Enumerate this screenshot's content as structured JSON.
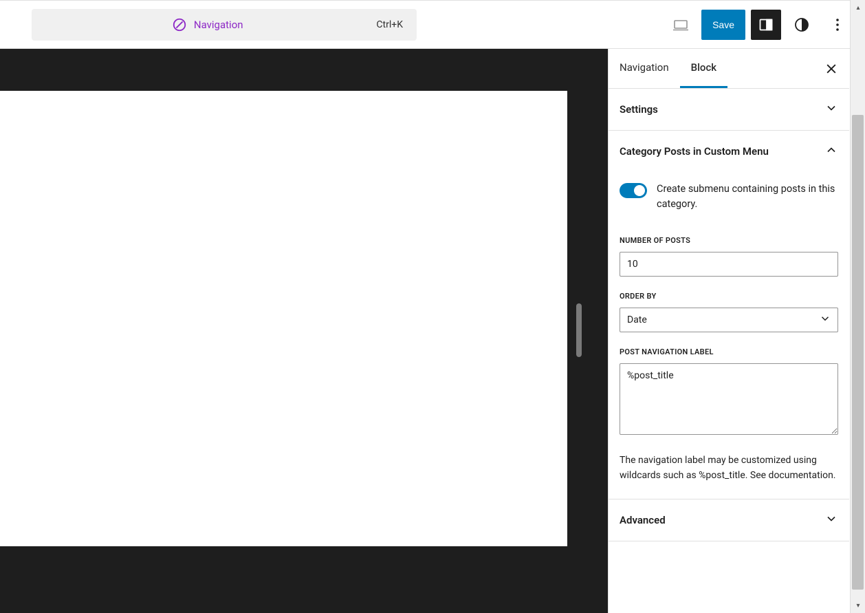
{
  "topbar": {
    "nav_label": "Navigation",
    "shortcut": "Ctrl+K",
    "save_label": "Save"
  },
  "sidebar": {
    "tabs": {
      "navigation": "Navigation",
      "block": "Block"
    },
    "panels": {
      "settings": {
        "title": "Settings"
      },
      "category_posts": {
        "title": "Category Posts in Custom Menu",
        "toggle_label": "Create submenu containing posts in this category.",
        "number_of_posts": {
          "label": "Number of posts",
          "value": "10"
        },
        "order_by": {
          "label": "Order by",
          "value": "Date"
        },
        "post_nav_label": {
          "label": "Post navigation label",
          "value": "%post_title",
          "help": "The navigation label may be customized using wildcards such as %post_title. See documentation."
        }
      },
      "advanced": {
        "title": "Advanced"
      }
    }
  }
}
